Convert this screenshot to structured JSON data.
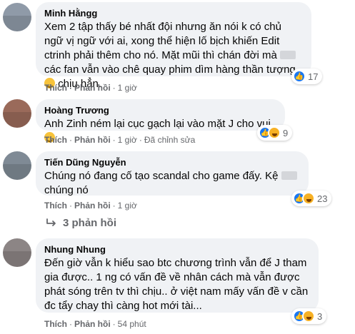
{
  "comments": [
    {
      "author": "Minh Hằngg",
      "text_parts": [
        "Xem 2 tập thấy bé nhất đội nhưng ăn nói k có chủ ngữ vị ngữ với ai, xong thể hiện lố bịch khiến Edit ctrinh phải thêm cho nó. Mặt mũi thì chán đời mà",
        "các fan vẫn vào chê quay phim dìm hàng thần tượng",
        "chịu hẳn."
      ],
      "actions": {
        "like": "Thích",
        "reply": "Phản hồi",
        "time": "1 giờ"
      },
      "reaction_count": "17"
    },
    {
      "author": "Hoàng Trương",
      "text": "Anh Zinh ném lại cục gạch lại vào mặt J cho vui",
      "actions": {
        "like": "Thích",
        "reply": "Phản hồi",
        "time": "1 giờ",
        "edited": "Đã chỉnh sửa"
      },
      "reaction_count": "9"
    },
    {
      "author": "Tiến Dũng Nguyễn",
      "text_parts": [
        "Chúng nó đang cố tạo scandal cho game đấy. Kệ",
        "chúng nó"
      ],
      "actions": {
        "like": "Thích",
        "reply": "Phản hồi",
        "time": "1 giờ"
      },
      "reaction_count": "23",
      "replies_label": "3 phản hồi"
    },
    {
      "author": "Nhung Nhung",
      "text": "Đến giờ vẫn k hiểu sao btc chương trình vẫn để J tham gia được.. 1 ng có vấn đề về nhân cách mà vẫn được phát sóng trên tv thì chịu.. ở việt nam mấy vấn đề v cần đc tẩy chay thì càng hot mới tài...",
      "actions": {
        "like": "Thích",
        "reply": "Phản hồi",
        "time": "54 phút"
      },
      "reaction_count": "3"
    }
  ],
  "colors": {
    "bubble": "#f0f2f5",
    "meta": "#65676b",
    "like_blue": "#1877f2"
  },
  "icons": {
    "like": "like-reaction-icon",
    "haha": "haha-reaction-icon",
    "reply": "reply-arrow-icon"
  }
}
